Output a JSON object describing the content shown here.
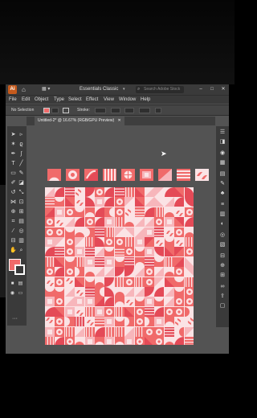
{
  "app": {
    "logo_text": "Ai",
    "workspace": "Essentials Classic",
    "stock_search_placeholder": "Search Adobe Stock",
    "window_buttons": [
      "–",
      "□",
      "✕"
    ]
  },
  "menu": [
    "File",
    "Edit",
    "Object",
    "Type",
    "Select",
    "Effect",
    "View",
    "Window",
    "Help"
  ],
  "control_bar": {
    "selection_label": "No Selection",
    "stroke_label": "Stroke:",
    "fill_color": "#f06a6a"
  },
  "document_tab": {
    "title": "Untitled-2* @ 16.67% (RGB/GPU Preview)",
    "close": "✕"
  },
  "colors": {
    "accent": "#f06a6a",
    "accent_dark": "#e44a57",
    "accent_light": "#f7b6bb",
    "paper": "#fbe3e5",
    "ui_dark": "#3a3a3a",
    "canvas": "#535353"
  },
  "icons": {
    "tools": [
      "selection-tool",
      "direct-selection-tool",
      "magic-wand-tool",
      "lasso-tool",
      "pen-tool",
      "curvature-tool",
      "type-tool",
      "line-tool",
      "rectangle-tool",
      "paintbrush-tool",
      "shaper-tool",
      "pencil-tool",
      "eraser-tool",
      "rotate-tool",
      "scale-tool",
      "width-tool",
      "free-transform-tool",
      "shape-builder-tool",
      "perspective-grid-tool",
      "mesh-tool",
      "gradient-tool",
      "eyedropper-tool",
      "blend-tool",
      "symbol-sprayer-tool",
      "column-graph-tool",
      "artboard-tool",
      "slice-tool",
      "hand-tool",
      "zoom-tool"
    ],
    "right_panels": [
      "properties-panel",
      "layers-panel",
      "libraries-panel",
      "color-panel",
      "color-guide-panel",
      "swatches-panel",
      "brushes-panel",
      "symbols-panel",
      "stroke-panel",
      "gradient-panel",
      "transparency-panel",
      "appearance-panel",
      "graphic-styles-panel",
      "align-panel",
      "pathfinder-panel",
      "transform-panel",
      "links-panel",
      "asset-export-panel"
    ]
  }
}
